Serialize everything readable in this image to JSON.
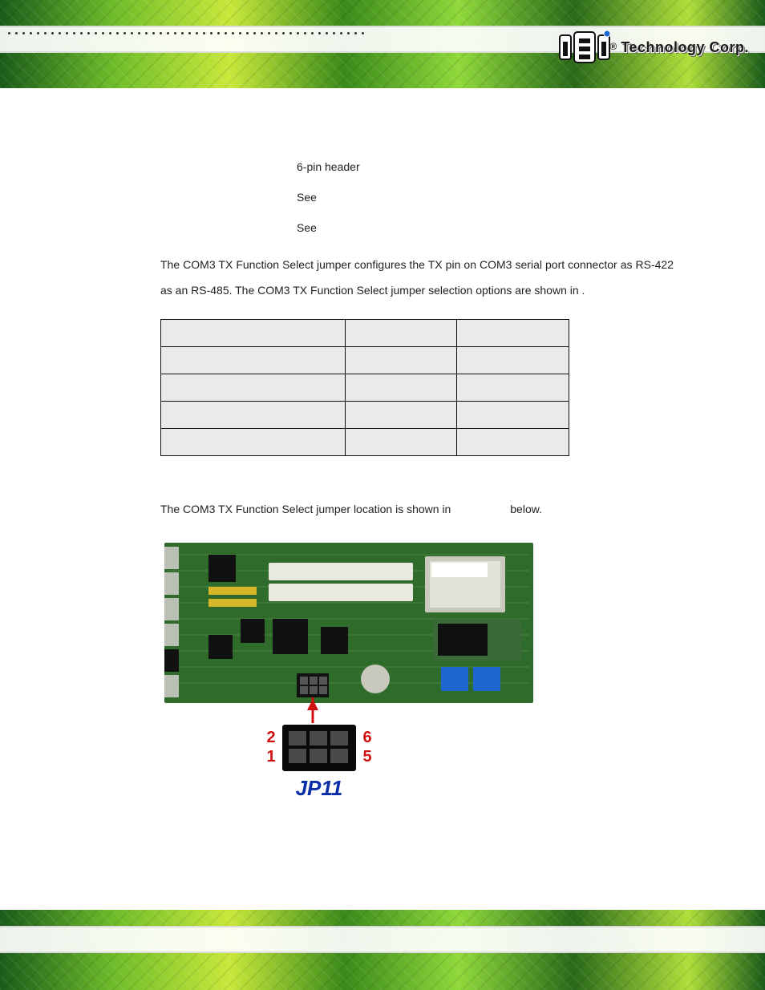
{
  "header": {
    "brand_text": "Technology Corp.",
    "trademark": "®"
  },
  "section": {
    "spec_rows": [
      {
        "label": "",
        "value": "6-pin header"
      },
      {
        "label": "",
        "value": "See"
      },
      {
        "label": "",
        "value": "See"
      }
    ],
    "paragraph1_pre": "The COM3 TX Function Select jumper configures the TX pin on COM3 serial port connector as RS-422 as an RS-485. The COM3 TX Function Select jumper selection options are shown in ",
    "paragraph1_post": ".",
    "table": {
      "headers": [
        "",
        "",
        ""
      ],
      "rows": [
        [
          "",
          "",
          ""
        ],
        [
          "",
          "",
          ""
        ],
        [
          "",
          "",
          ""
        ],
        [
          "",
          "",
          ""
        ]
      ]
    },
    "paragraph2_pre": "The COM3 TX Function Select jumper location is shown in ",
    "paragraph2_post": " below."
  },
  "figure": {
    "jumper_label": "JP11",
    "pin_left_top": "2",
    "pin_left_bottom": "1",
    "pin_right_top": "6",
    "pin_right_bottom": "5"
  }
}
